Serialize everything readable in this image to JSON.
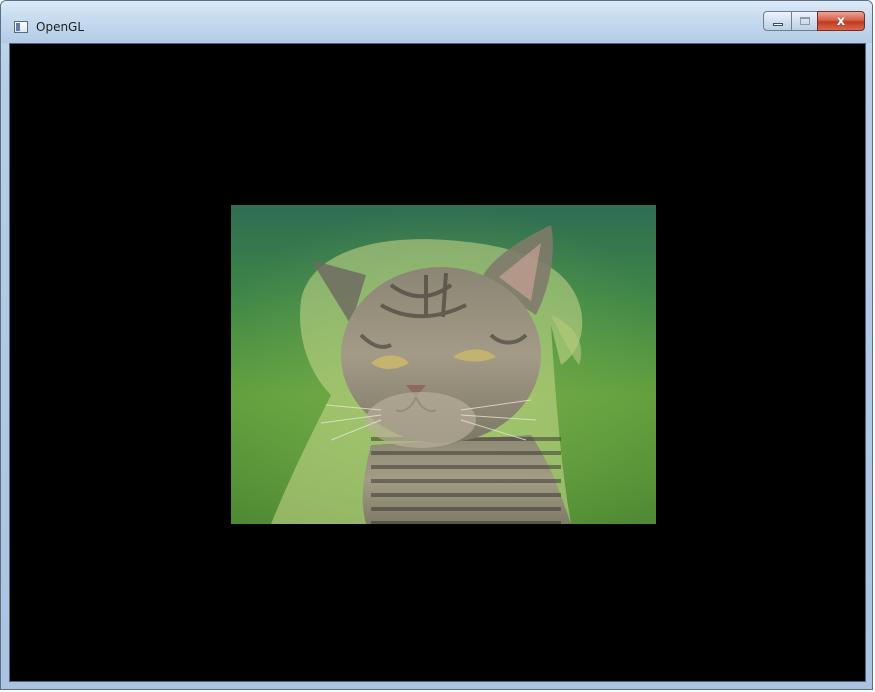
{
  "window": {
    "title": "OpenGL",
    "close_glyph": "x",
    "icons": {
      "app": "window-app-icon",
      "minimize": "minimize-icon",
      "maximize": "maximize-icon",
      "close": "close-icon"
    }
  },
  "viewport": {
    "background": "#000000",
    "image_subject": "kitten-blended-with-puppy"
  },
  "colors": {
    "titlebar": "#c6dbef",
    "close_button": "#c13a23",
    "grass_green": "#5f9a3e"
  }
}
